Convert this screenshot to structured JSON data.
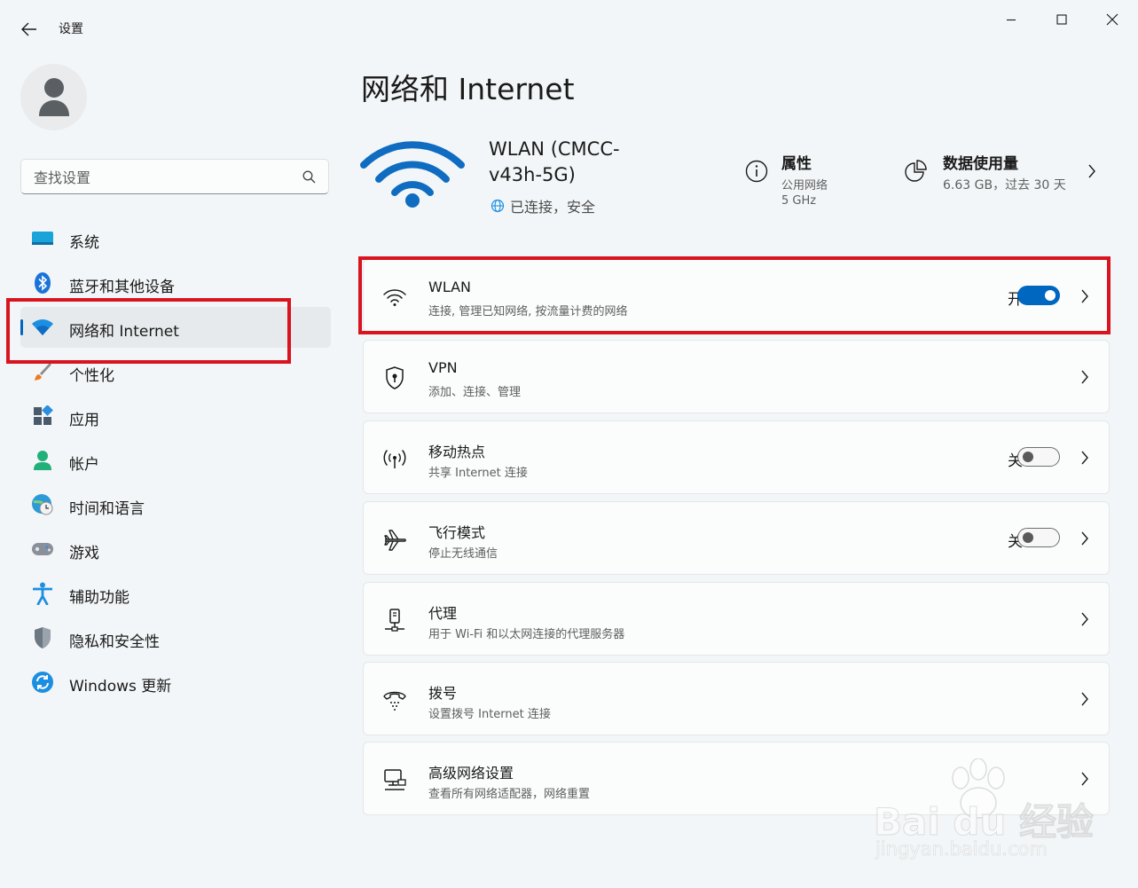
{
  "window": {
    "title": "设置",
    "controls": {
      "minimize": "minimize-icon",
      "maximize": "maximize-icon",
      "close": "close-icon"
    }
  },
  "search": {
    "placeholder": "查找设置"
  },
  "sidebar": {
    "items": [
      {
        "label": "系统",
        "icon": "monitor-icon"
      },
      {
        "label": "蓝牙和其他设备",
        "icon": "bluetooth-icon"
      },
      {
        "label": "网络和 Internet",
        "icon": "wifi-icon",
        "active": true
      },
      {
        "label": "个性化",
        "icon": "brush-icon"
      },
      {
        "label": "应用",
        "icon": "apps-icon"
      },
      {
        "label": "帐户",
        "icon": "account-icon"
      },
      {
        "label": "时间和语言",
        "icon": "clock-globe-icon"
      },
      {
        "label": "游戏",
        "icon": "gamepad-icon"
      },
      {
        "label": "辅助功能",
        "icon": "accessibility-icon"
      },
      {
        "label": "隐私和安全性",
        "icon": "shield-icon"
      },
      {
        "label": "Windows 更新",
        "icon": "update-icon"
      }
    ]
  },
  "main": {
    "title": "网络和 Internet",
    "network": {
      "name": "WLAN (CMCC-v43h-5G)",
      "status": "已连接，安全"
    },
    "properties": {
      "title": "属性",
      "sub1": "公用网络",
      "sub2": "5 GHz"
    },
    "data_usage": {
      "title": "数据使用量",
      "sub": "6.63 GB，过去 30 天"
    },
    "cards": [
      {
        "title": "WLAN",
        "sub": "连接, 管理已知网络, 按流量计费的网络",
        "icon": "wifi-icon",
        "state": "开",
        "toggle_on": true
      },
      {
        "title": "VPN",
        "sub": "添加、连接、管理",
        "icon": "vpn-shield-icon"
      },
      {
        "title": "移动热点",
        "sub": "共享 Internet 连接",
        "icon": "hotspot-icon",
        "state": "关",
        "toggle_on": false
      },
      {
        "title": "飞行模式",
        "sub": "停止无线通信",
        "icon": "airplane-icon",
        "state": "关",
        "toggle_on": false
      },
      {
        "title": "代理",
        "sub": "用于 Wi-Fi 和以太网连接的代理服务器",
        "icon": "proxy-icon"
      },
      {
        "title": "拨号",
        "sub": "设置拨号 Internet 连接",
        "icon": "dialup-icon"
      },
      {
        "title": "高级网络设置",
        "sub": "查看所有网络适配器，网络重置",
        "icon": "advanced-network-icon"
      }
    ]
  },
  "watermark": {
    "brand": "Bai du 经验",
    "url": "jingyan.baidu.com"
  },
  "colors": {
    "accent": "#0067c0",
    "highlight": "#d9141f"
  }
}
